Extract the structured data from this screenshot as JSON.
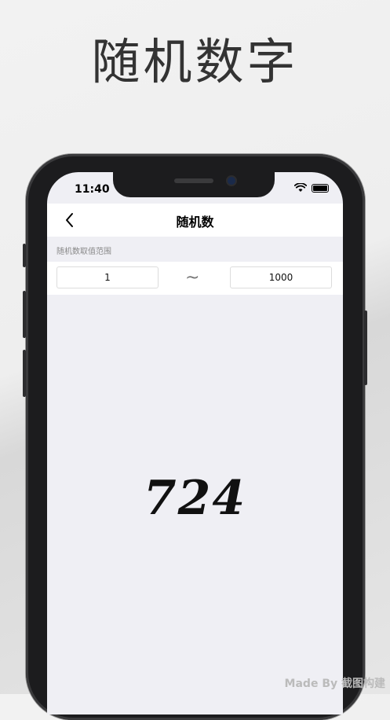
{
  "headline": "随机数字",
  "status_bar": {
    "time": "11:40"
  },
  "nav": {
    "title": "随机数"
  },
  "range": {
    "label": "随机数取值范围",
    "min": "1",
    "separator": "~",
    "max": "1000"
  },
  "result": {
    "value": "724"
  },
  "watermark": "Made By 截图构建"
}
